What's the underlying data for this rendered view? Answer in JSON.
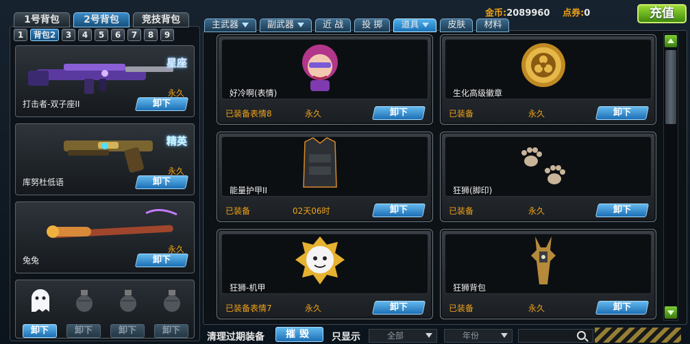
{
  "top": {
    "gold_label": "金币:",
    "gold_value": "2089960",
    "points_label": "点券:",
    "points_value": "0",
    "recharge": "充值"
  },
  "bag_tabs": [
    "1号背包",
    "2号背包",
    "竞技背包"
  ],
  "num_tabs": [
    "1",
    "背包2",
    "3",
    "4",
    "5",
    "6",
    "7",
    "8",
    "9"
  ],
  "weapons": [
    {
      "name": "打击者-双子座II",
      "badge": "星座",
      "duration": "永久",
      "button": "卸下"
    },
    {
      "name": "库努杜低语",
      "badge": "精英",
      "duration": "永久",
      "button": "卸下"
    },
    {
      "name": "兔兔",
      "badge": "",
      "duration": "永久",
      "button": "卸下"
    }
  ],
  "slots": [
    {
      "icon": "ghost-icon",
      "button": "卸下",
      "active": true
    },
    {
      "icon": "grenade-icon",
      "button": "卸下",
      "active": false
    },
    {
      "icon": "grenade-icon",
      "button": "卸下",
      "active": false
    },
    {
      "icon": "grenade-icon",
      "button": "卸下",
      "active": false
    }
  ],
  "categories": [
    "主武器",
    "副武器",
    "近 战",
    "投 掷",
    "道具",
    "皮肤",
    "材料"
  ],
  "items": [
    {
      "name": "好冷啊(表情)",
      "status": "已装备表情8",
      "duration": "永久",
      "button": "卸下",
      "icon": "emote-girl-icon"
    },
    {
      "name": "生化高级徽章",
      "status": "已装备",
      "duration": "永久",
      "button": "卸下",
      "icon": "biohazard-badge-icon"
    },
    {
      "name": "能量护甲II",
      "status": "已装备",
      "duration": "02天06时",
      "button": "卸下",
      "icon": "armor-vest-icon"
    },
    {
      "name": "狂狮(脚印)",
      "status": "已装备",
      "duration": "永久",
      "button": "卸下",
      "icon": "pawprint-icon"
    },
    {
      "name": "狂狮-机甲",
      "status": "已装备表情7",
      "duration": "永久",
      "button": "卸下",
      "icon": "lion-mecha-emote-icon"
    },
    {
      "name": "狂狮背包",
      "status": "已装备",
      "duration": "永久",
      "button": "卸下",
      "icon": "lion-backpack-icon"
    }
  ],
  "bottom": {
    "clear_label": "清理过期装备",
    "destroy": "摧毁",
    "show_label": "只显示",
    "filter_all": "全部",
    "filter_year": "年份"
  },
  "colors": {
    "accent_blue": "#1c6fb4",
    "gold": "#f0a21a",
    "recharge_green": "#5aa41c"
  }
}
